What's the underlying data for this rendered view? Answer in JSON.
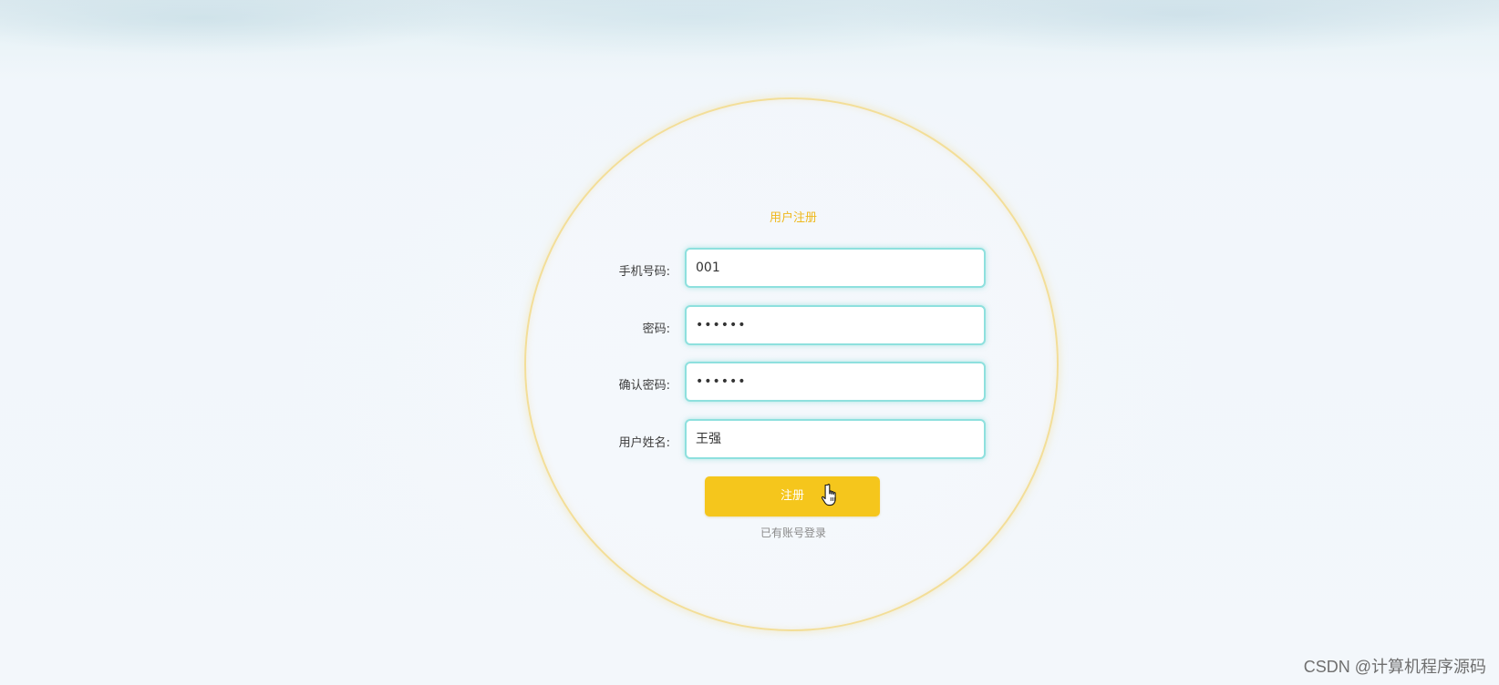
{
  "form": {
    "title": "用户注册",
    "fields": [
      {
        "label": "手机号码:",
        "value": "001"
      },
      {
        "label": "密码:",
        "value": "••••••"
      },
      {
        "label": "确认密码:",
        "value": "••••••"
      },
      {
        "label": "用户姓名:",
        "value": "王强"
      }
    ],
    "submit_label": "注册",
    "login_link": "已有账号登录"
  },
  "watermark": "CSDN @计算机程序源码",
  "colors": {
    "accent": "#f5c61c",
    "title": "#efb81c",
    "input_border": "#8ee0de",
    "circle_border": "#f3de98"
  },
  "icons": {
    "cursor": "hand-pointer-icon"
  }
}
